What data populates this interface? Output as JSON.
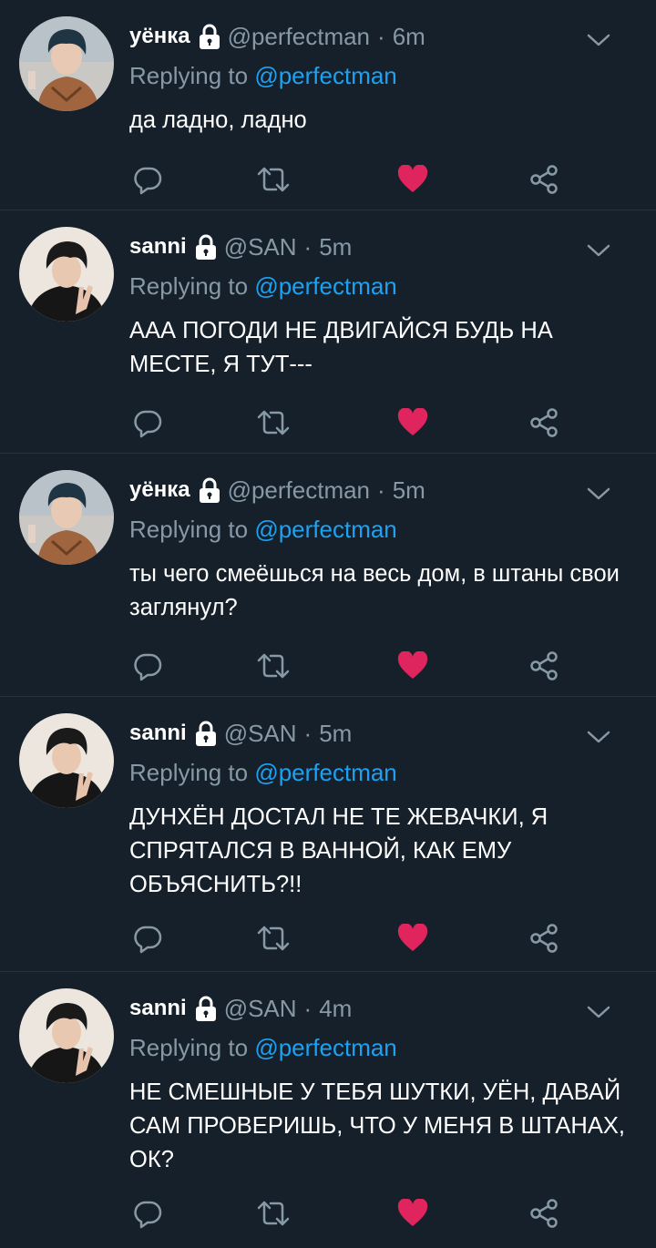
{
  "tweets": [
    {
      "display_name": "уёнка",
      "handle": "@perfectman",
      "time": "6m",
      "reply_prefix": "Replying to",
      "reply_to": "@perfectman",
      "text": "да ладно, ладно",
      "avatar": "yeonka-avatar"
    },
    {
      "display_name": "sanni",
      "handle": "@SAN",
      "time": "5m",
      "reply_prefix": "Replying to",
      "reply_to": "@perfectman",
      "text": "ААА ПОГОДИ НЕ ДВИГАЙСЯ БУДЬ НА МЕСТЕ, Я ТУТ---",
      "avatar": "sanni-avatar"
    },
    {
      "display_name": "уёнка",
      "handle": "@perfectman",
      "time": "5m",
      "reply_prefix": "Replying to",
      "reply_to": "@perfectman",
      "text": "ты чего смеёшься на весь дом, в штаны свои заглянул?",
      "avatar": "yeonka-avatar"
    },
    {
      "display_name": "sanni",
      "handle": "@SAN",
      "time": "5m",
      "reply_prefix": "Replying to",
      "reply_to": "@perfectman",
      "text": "ДУНХЁН ДОСТАЛ НЕ ТЕ ЖЕВАЧКИ, Я СПРЯТАЛСЯ В ВАННОЙ, КАК ЕМУ ОБЪЯСНИТЬ?!!",
      "avatar": "sanni-avatar"
    },
    {
      "display_name": "sanni",
      "handle": "@SAN",
      "time": "4m",
      "reply_prefix": "Replying to",
      "reply_to": "@perfectman",
      "text": "НЕ СМЕШНЫЕ У ТЕБЯ ШУТКИ, УЁН, ДАВАЙ САМ ПРОВЕРИШЬ, ЧТО У МЕНЯ В ШТАНАХ, ОК?",
      "avatar": "sanni-avatar"
    }
  ],
  "dot_separator": "·",
  "icons": {
    "reply": "reply-icon",
    "retweet": "retweet-icon",
    "like": "heart-icon",
    "share": "share-icon",
    "lock": "lock-icon",
    "more": "chevron-down-icon"
  },
  "colors": {
    "background": "#15202b",
    "muted": "#8899a6",
    "link": "#1da1f2",
    "like": "#e0245e",
    "divider": "#253341"
  }
}
